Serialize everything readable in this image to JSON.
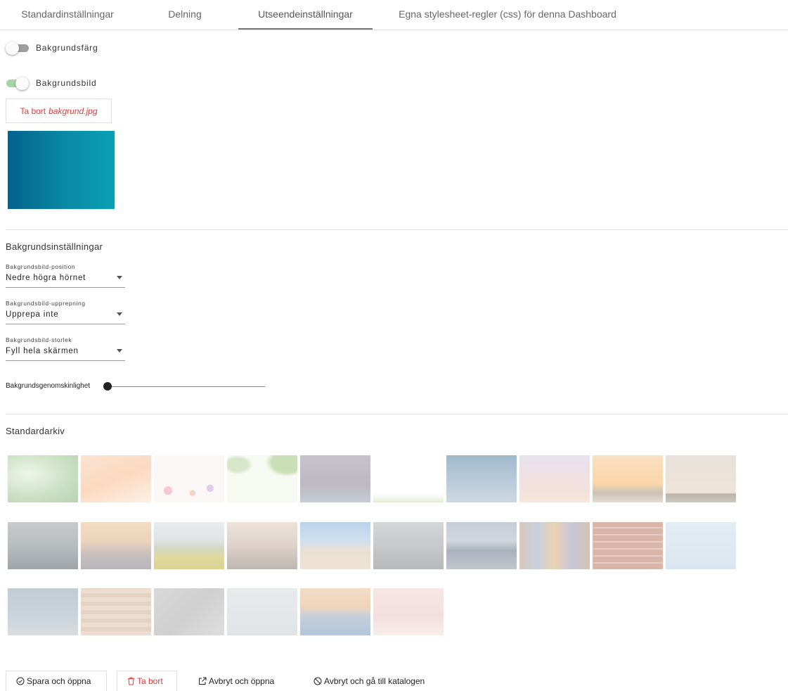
{
  "tabs": [
    {
      "label": "Standardinställningar",
      "active": false
    },
    {
      "label": "Delning",
      "active": false
    },
    {
      "label": "Utseendeinställningar",
      "active": true
    },
    {
      "label": "Egna stylesheet-regler (css) för denna Dashboard",
      "active": false
    }
  ],
  "background_color": {
    "label": "Bakgrundsfärg",
    "enabled": false
  },
  "background_image": {
    "label": "Bakgrundsbild",
    "enabled": true,
    "remove_prefix": "Ta bort",
    "file_name": "bakgrund.jpg"
  },
  "settings": {
    "title": "Bakgrundsinställningar",
    "position": {
      "label": "Bakgrundsbild-position",
      "value": "Nedre högra hörnet"
    },
    "repeat": {
      "label": "Bakgrundsbild-upprepning",
      "value": "Upprepa inte"
    },
    "size": {
      "label": "Bakgrundsbild-storlek",
      "value": "Fyll hela skärmen"
    },
    "opacity": {
      "label": "Bakgrundsgenomskinlighet",
      "value": 0
    }
  },
  "archive": {
    "title": "Standardarkiv",
    "image_count": 26
  },
  "footer": {
    "save": "Spara och öppna",
    "delete": "Ta bort",
    "cancel_open": "Avbryt och öppna",
    "cancel_catalog": "Avbryt och gå till katalogen"
  },
  "colors": {
    "accent_danger": "#e53935",
    "toggle_on": "#a5d6a7",
    "preview_start": "#04628c",
    "preview_end": "#0aa1b5"
  }
}
